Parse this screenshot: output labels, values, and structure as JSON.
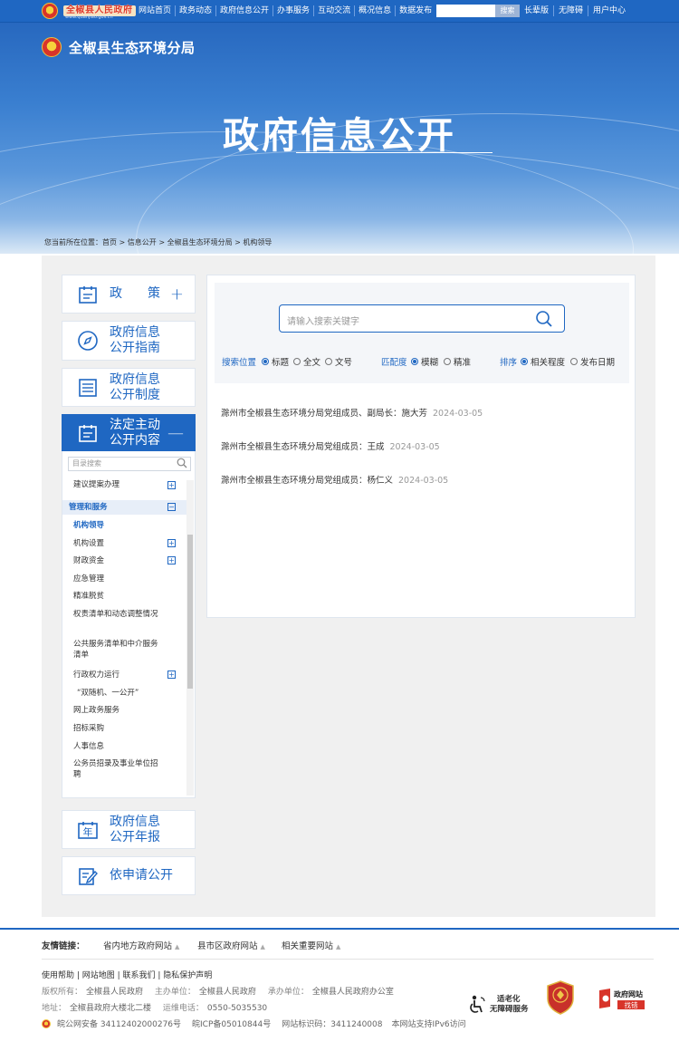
{
  "top": {
    "logo_text": "全椒县人民政府",
    "logo_url": "www.quanjiao.gov.cn",
    "nav": [
      "网站首页",
      "政务动态",
      "政府信息公开",
      "办事服务",
      "互动交流",
      "概况信息",
      "数据发布"
    ],
    "search_btn": "搜索",
    "util": [
      "长辈版",
      "无障碍",
      "用户中心"
    ]
  },
  "banner": {
    "dept_name": "全椒县生态环境分局",
    "title": "政府信息公开",
    "breadcrumb": "您当前所在位置：首页 > 信息公开 > 全椒县生态环境分局 > 机构领导"
  },
  "sidebar": {
    "policy": "政　　策",
    "guide": [
      "政府信息",
      "公开指南"
    ],
    "system": [
      "政府信息",
      "公开制度"
    ],
    "active": [
      "法定主动",
      "公开内容"
    ],
    "annual": [
      "政府信息",
      "公开年报"
    ],
    "apply": "依申请公开"
  },
  "catalog": {
    "search_placeholder": "目录搜索",
    "items": [
      {
        "label": "建议提案办理",
        "expand": true
      },
      {
        "label": "管理和服务",
        "group": true
      },
      {
        "label": "机构领导",
        "active": true
      },
      {
        "label": "机构设置",
        "expand": true
      },
      {
        "label": "财政资金",
        "expand": true
      },
      {
        "label": "应急管理"
      },
      {
        "label": "精准脱贫"
      },
      {
        "label": "权责清单和动态调整情况"
      },
      {
        "label": "公共服务清单和中介服务清单"
      },
      {
        "label": "行政权力运行",
        "expand": true
      },
      {
        "label": "“双随机、一公开”"
      },
      {
        "label": "网上政务服务"
      },
      {
        "label": "招标采购"
      },
      {
        "label": "人事信息"
      },
      {
        "label": "公务员招录及事业单位招聘"
      }
    ]
  },
  "search": {
    "placeholder": "请输入搜索关键字",
    "position_label": "搜索位置",
    "position_opts": [
      "标题",
      "全文",
      "文号"
    ],
    "match_label": "匹配度",
    "match_opts": [
      "模糊",
      "精准"
    ],
    "sort_label": "排序",
    "sort_opts": [
      "相关程度",
      "发布日期"
    ]
  },
  "results": [
    {
      "title": "滁州市全椒县生态环境分局党组成员、副局长：施大芳",
      "date": "2024-03-05"
    },
    {
      "title": "滁州市全椒县生态环境分局党组成员：王成",
      "date": "2024-03-05"
    },
    {
      "title": "滁州市全椒县生态环境分局党组成员：杨仁义",
      "date": "2024-03-05"
    }
  ],
  "footer": {
    "links_label": "友情链接：",
    "links": [
      "省内地方政府网站",
      "县市区政府网站",
      "相关重要网站"
    ],
    "help": "使用帮助 | 网站地图 | 联系我们 | 隐私保护声明",
    "owner_k": "版权所有：",
    "owner": "全椒县人民政府",
    "host_k": "主办单位：",
    "host": "全椒县人民政府",
    "org_k": "承办单位：",
    "org": "全椒县人民政府办公室",
    "addr_k": "地址：",
    "addr": "全椒县政府大楼北二楼",
    "phone_k": "运维电话：",
    "phone": "0550-5035530",
    "record": "皖公网安备 34112402000276号",
    "icp": "皖ICP备05010844号",
    "site_id": "网站标识码：3411240008",
    "ipv6": "本网站支持IPv6访问",
    "access_badge": [
      "适老化",
      "无障碍服务"
    ],
    "gov_badge": [
      "政府网站",
      "找错"
    ]
  },
  "colors": {
    "primary": "#1f67c2",
    "banner": "#2f73c9"
  }
}
